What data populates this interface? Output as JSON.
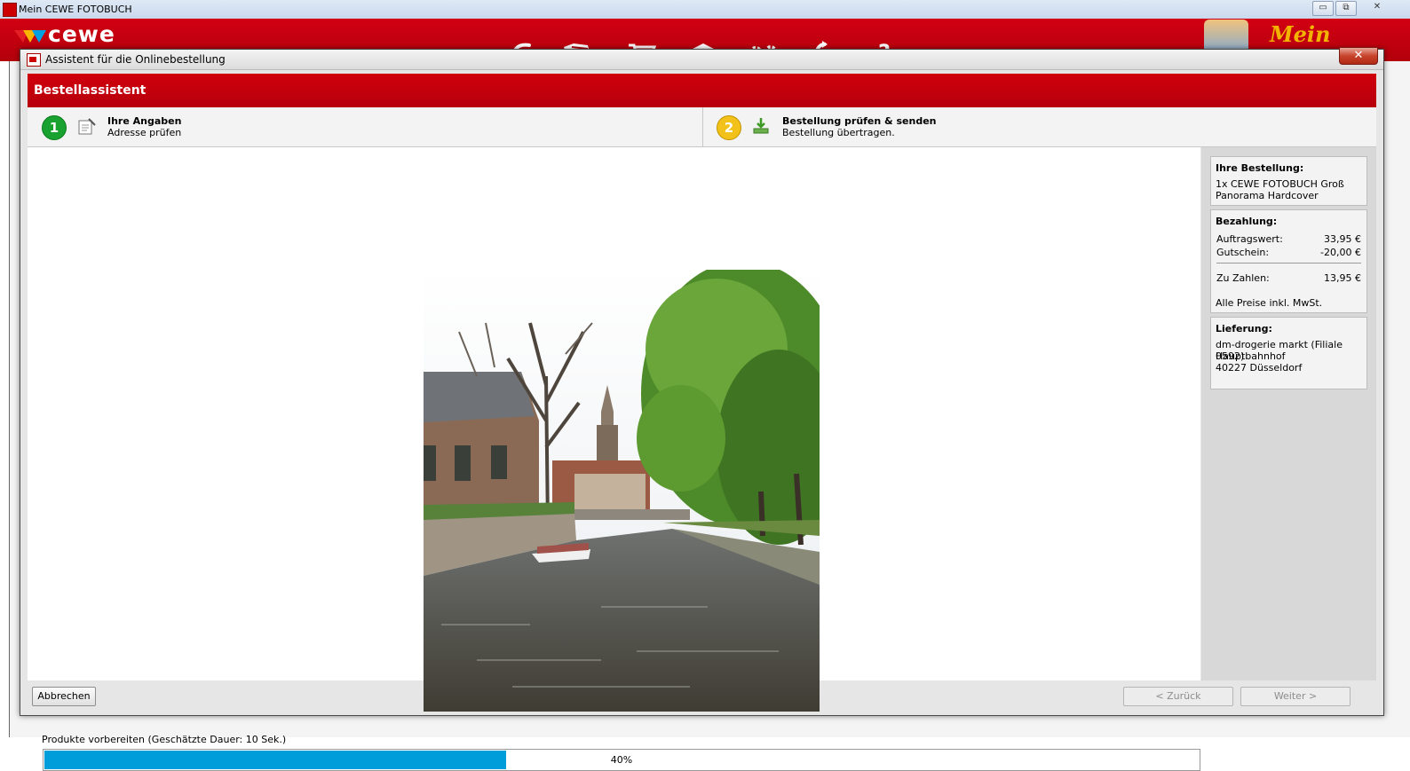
{
  "app": {
    "title": "Mein CEWE FOTOBUCH",
    "logo_text": "cewe",
    "brand_right": "Mein",
    "window_buttons": {
      "minimize": "▭",
      "restore": "⧉",
      "close": "✕"
    },
    "toolbar_icons": [
      "undo-arrow-icon",
      "folder-icon",
      "cart-icon",
      "products-icon",
      "gears-icon",
      "refresh-icon",
      "help-icon"
    ]
  },
  "dialog": {
    "title": "Assistent für die Onlinebestellung",
    "close_label": "✕",
    "header": "Bestellassistent",
    "steps": [
      {
        "number": "1",
        "title": "Ihre Angaben",
        "subtitle": "Adresse prüfen",
        "color": "#1aa231"
      },
      {
        "number": "2",
        "title": "Bestellung prüfen & senden",
        "subtitle": "Bestellung übertragen.",
        "color": "#f2c21a"
      }
    ],
    "progress": {
      "label": "Produkte vorbereiten (Geschätzte Dauer: 10 Sek.)",
      "percent_text": "40%",
      "value": 0.4,
      "color": "#009ddb"
    },
    "sidebar": {
      "order": {
        "heading": "Ihre Bestellung:",
        "line1": "1x CEWE FOTOBUCH Groß",
        "line2": "Panorama Hardcover"
      },
      "payment": {
        "heading": "Bezahlung:",
        "rows": [
          {
            "label": "Auftragswert:",
            "value": "33,95 €"
          },
          {
            "label": "Gutschein:",
            "value": "-20,00 €"
          },
          {
            "label": "Zu Zahlen:",
            "value": "13,95 €"
          }
        ],
        "note": "Alle Preise inkl. MwSt."
      },
      "delivery": {
        "heading": "Lieferung:",
        "line1": "dm-drogerie markt (Filiale 0592)",
        "line2": "Hauptbahnhof",
        "line3": "40227 Düsseldorf"
      }
    },
    "buttons": {
      "cancel": "Abbrechen",
      "back": "< Zurück",
      "next": "Weiter >"
    }
  }
}
